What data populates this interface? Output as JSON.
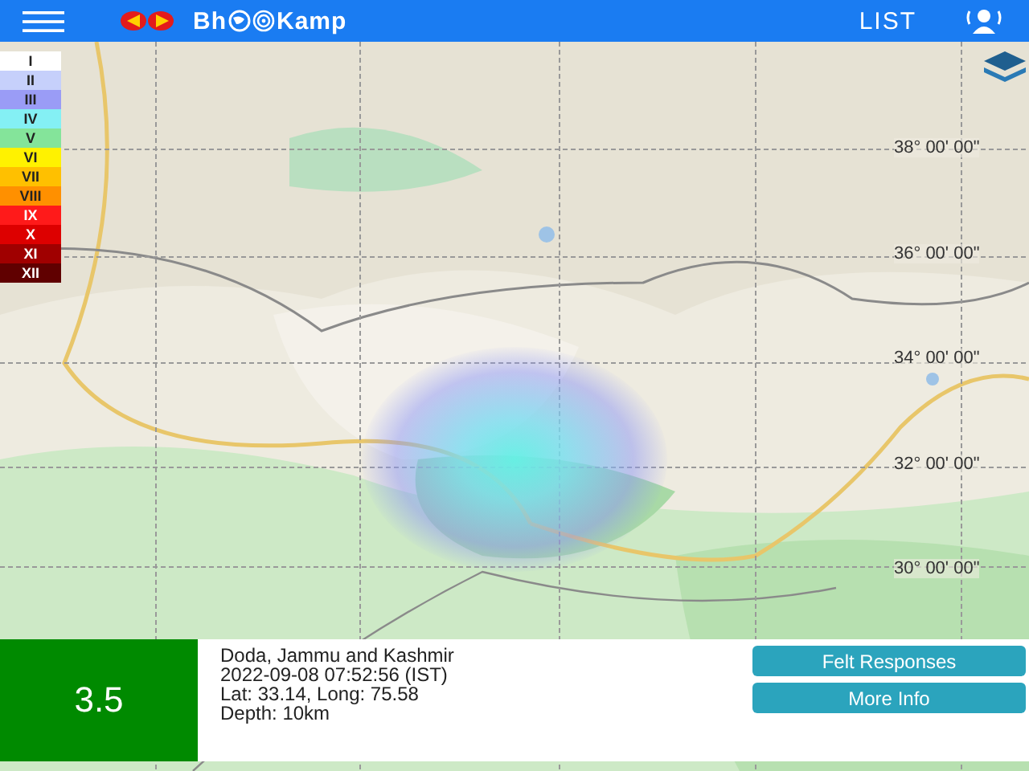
{
  "header": {
    "title_left": "Bh",
    "title_right": "Kamp",
    "list_link": "LIST"
  },
  "legend": [
    {
      "label": "I",
      "color": "#ffffff"
    },
    {
      "label": "II",
      "color": "#c6d0fb"
    },
    {
      "label": "III",
      "color": "#9a9cf6"
    },
    {
      "label": "IV",
      "color": "#84f0f4"
    },
    {
      "label": "V",
      "color": "#84e49a"
    },
    {
      "label": "VI",
      "color": "#fff200"
    },
    {
      "label": "VII",
      "color": "#ffc000"
    },
    {
      "label": "VIII",
      "color": "#ff9000"
    },
    {
      "label": "IX",
      "color": "#ff1a1a"
    },
    {
      "label": "X",
      "color": "#dd0000"
    },
    {
      "label": "XI",
      "color": "#a00000"
    },
    {
      "label": "XII",
      "color": "#600000"
    }
  ],
  "latitude_labels": [
    "38° 00' 00\"",
    "36° 00' 00\"",
    "34° 00' 00\"",
    "32° 00' 00\"",
    "30° 00' 00\""
  ],
  "event": {
    "magnitude": "3.5",
    "color": "#008a00",
    "location": "Doda, Jammu and Kashmir",
    "time": "2022-09-08 07:52:56 (IST)",
    "coordinates": "Lat: 33.14, Long: 75.58",
    "depth": "Depth: 10km"
  },
  "buttons": [
    "Felt Responses",
    "More Info"
  ]
}
